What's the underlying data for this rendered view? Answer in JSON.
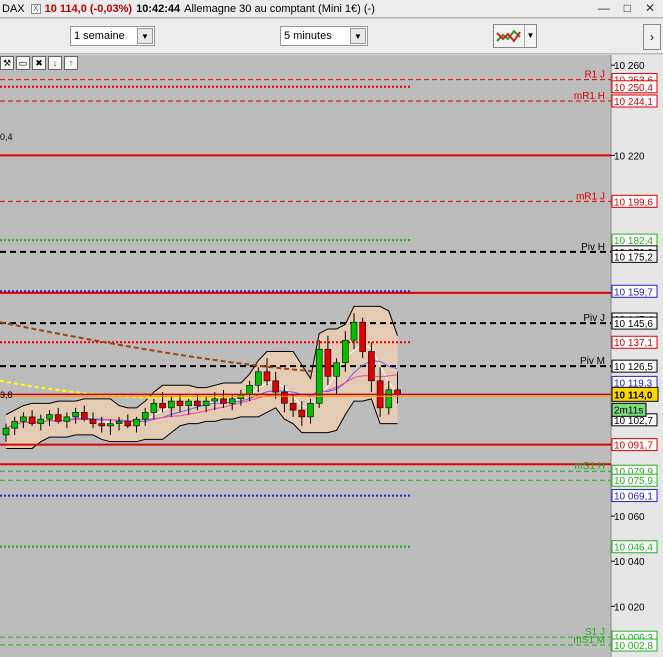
{
  "titlebar": {
    "symbol": "DAX",
    "checkbox": "X",
    "price": "10 114,0 (-0,03%)",
    "time": "10:42:44",
    "instrument": "Allemagne 30 au comptant (Mini 1€) (-)",
    "minimize": "—",
    "maximize": "□",
    "close": "✕"
  },
  "toolbar": {
    "period": "1 semaine",
    "interval": "5 minutes",
    "dropdown_arrow": "▼",
    "scroll_right": "›"
  },
  "colors": {
    "background": "#bcbcbc",
    "red_level": "#e00000",
    "green_level": "#20b020",
    "blue_level": "#2020d0",
    "pivot": "#000000",
    "bull_candle": "#00c000",
    "bear_candle": "#e00000",
    "band_fill": "#e8cdb2",
    "current_price_bg": "#ffd700",
    "timer_bg": "#7ed87e"
  },
  "chart": {
    "left_label": "0,4",
    "left_label2": "3,8"
  },
  "levels": [
    {
      "label": "R1 J",
      "value": "10 253,6",
      "price": 10253.6,
      "style": "dash",
      "color": "red"
    },
    {
      "label": "",
      "value": "10 250,4",
      "price": 10250.4,
      "style": "dot",
      "color": "red"
    },
    {
      "label": "mR1 H",
      "value": "10 244,1",
      "price": 10244.1,
      "style": "dash",
      "color": "red"
    },
    {
      "label": "",
      "value": "",
      "price": 10220.0,
      "style": "solid",
      "color": "red"
    },
    {
      "label": "mR1 J",
      "value": "10 199,6",
      "price": 10199.6,
      "style": "dash",
      "color": "red"
    },
    {
      "label": "",
      "value": "10 182,4",
      "price": 10182.4,
      "style": "dot",
      "color": "green"
    },
    {
      "label": "Piv H",
      "value": "10 176,2",
      "price": 10177.2,
      "style": "bigdash",
      "color": "black"
    },
    {
      "label": "",
      "value": "10 175,2",
      "price": 10175.2,
      "style": "none",
      "color": "black"
    },
    {
      "label": "",
      "value": "10 159,7",
      "price": 10159.7,
      "style": "dot",
      "color": "blue"
    },
    {
      "label": "",
      "value": "",
      "price": 10159.0,
      "style": "solid",
      "color": "red"
    },
    {
      "label": "",
      "value": "10 147,4",
      "price": 10147.4,
      "style": "none",
      "color": "black"
    },
    {
      "label": "Piv J",
      "value": "10 145,6",
      "price": 10145.6,
      "style": "bigdash",
      "color": "black"
    },
    {
      "label": "",
      "value": "10 137,1",
      "price": 10137.1,
      "style": "dot",
      "color": "red"
    },
    {
      "label": "Piv M",
      "value": "10 126,5",
      "price": 10126.5,
      "style": "bigdash",
      "color": "black"
    },
    {
      "label": "",
      "value": "10 119,3",
      "price": 10119.3,
      "style": "none",
      "color": "blue"
    },
    {
      "label": "",
      "value": "10 102,7",
      "price": 10102.7,
      "style": "none",
      "color": "black"
    },
    {
      "label": "",
      "value": "10 091,7",
      "price": 10091.7,
      "style": "solid",
      "color": "red"
    },
    {
      "label": "",
      "value": "",
      "price": 10083.0,
      "style": "solid",
      "color": "red"
    },
    {
      "label": "mS1 H",
      "value": "10 079,9",
      "price": 10079.9,
      "style": "dash",
      "color": "green"
    },
    {
      "label": "",
      "value": "10 075,9",
      "price": 10075.9,
      "style": "dash",
      "color": "green"
    },
    {
      "label": "",
      "value": "10 069,1",
      "price": 10069.1,
      "style": "dot",
      "color": "blue"
    },
    {
      "label": "",
      "value": "10 046,4",
      "price": 10046.4,
      "style": "dot",
      "color": "green"
    },
    {
      "label": "S1 J",
      "value": "10 006,3",
      "price": 10006.3,
      "style": "dash",
      "color": "green"
    },
    {
      "label": "mS1 M",
      "value": "10 002,8",
      "price": 10002.8,
      "style": "dash",
      "color": "green"
    }
  ],
  "axis_ticks": [
    {
      "price": 10260,
      "label": "10 260"
    },
    {
      "price": 10220,
      "label": "10 220"
    },
    {
      "price": 10060,
      "label": "10 060"
    },
    {
      "price": 10040,
      "label": "10 040"
    },
    {
      "price": 10020,
      "label": "10 020"
    }
  ],
  "current": {
    "price": 10114.0,
    "value": "10 114,0",
    "timer": "2m11s"
  },
  "candles": [
    [
      10096,
      10101,
      10093,
      10099
    ],
    [
      10099,
      10104,
      10096,
      10102
    ],
    [
      10102,
      10106,
      10099,
      10104
    ],
    [
      10104,
      10107,
      10100,
      10101
    ],
    [
      10101,
      10105,
      10098,
      10103
    ],
    [
      10103,
      10107,
      10100,
      10105
    ],
    [
      10105,
      10108,
      10101,
      10102
    ],
    [
      10102,
      10106,
      10099,
      10104
    ],
    [
      10104,
      10108,
      10101,
      10106
    ],
    [
      10106,
      10109,
      10102,
      10103
    ],
    [
      10103,
      10106,
      10099,
      10101
    ],
    [
      10101,
      10104,
      10097,
      10100
    ],
    [
      10100,
      10103,
      10096,
      10101
    ],
    [
      10101,
      10104,
      10098,
      10102
    ],
    [
      10102,
      10105,
      10099,
      10100
    ],
    [
      10100,
      10104,
      10097,
      10103
    ],
    [
      10103,
      10108,
      10100,
      10106
    ],
    [
      10106,
      10112,
      10103,
      10110
    ],
    [
      10110,
      10115,
      10106,
      10108
    ],
    [
      10108,
      10113,
      10104,
      10111
    ],
    [
      10111,
      10114,
      10106,
      10109
    ],
    [
      10109,
      10112,
      10105,
      10111
    ],
    [
      10111,
      10114,
      10107,
      10109
    ],
    [
      10109,
      10113,
      10106,
      10111
    ],
    [
      10111,
      10115,
      10107,
      10112
    ],
    [
      10112,
      10116,
      10108,
      10110
    ],
    [
      10110,
      10114,
      10107,
      10112
    ],
    [
      10112,
      10116,
      10109,
      10114
    ],
    [
      10114,
      10120,
      10111,
      10118
    ],
    [
      10118,
      10126,
      10115,
      10124
    ],
    [
      10124,
      10130,
      10118,
      10120
    ],
    [
      10120,
      10124,
      10112,
      10115
    ],
    [
      10115,
      10118,
      10106,
      10110
    ],
    [
      10110,
      10114,
      10104,
      10107
    ],
    [
      10107,
      10111,
      10100,
      10104
    ],
    [
      10104,
      10112,
      10101,
      10110
    ],
    [
      10110,
      10138,
      10108,
      10134
    ],
    [
      10134,
      10140,
      10118,
      10122
    ],
    [
      10122,
      10130,
      10114,
      10128
    ],
    [
      10128,
      10142,
      10124,
      10138
    ],
    [
      10138,
      10150,
      10134,
      10146
    ],
    [
      10146,
      10148,
      10130,
      10133
    ],
    [
      10133,
      10137,
      10115,
      10120
    ],
    [
      10120,
      10126,
      10104,
      10108
    ],
    [
      10108,
      10120,
      10105,
      10116
    ],
    [
      10116,
      10124,
      10110,
      10114
    ]
  ]
}
